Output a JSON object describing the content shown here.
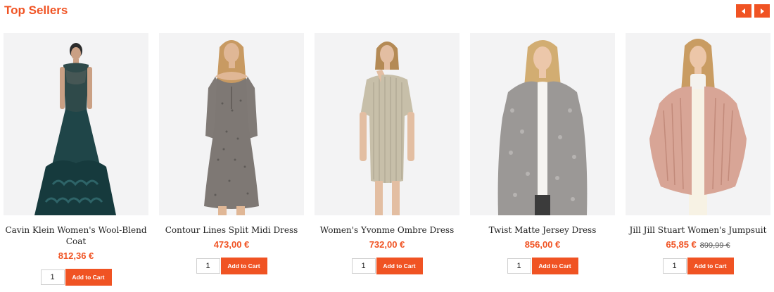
{
  "section": {
    "title": "Top Sellers"
  },
  "nav": {
    "prev_icon": "caret-left-icon",
    "next_icon": "caret-right-icon"
  },
  "colors": {
    "accent": "#f05323",
    "image_bg": "#f3f3f4"
  },
  "products": [
    {
      "name": "Cavin Klein Women's Wool-Blend Coat",
      "price": "812,36 €",
      "old_price": "",
      "qty": "1",
      "cart_label": "Add to Cart",
      "image": "woman-in-dark-teal-gown"
    },
    {
      "name": "Contour Lines Split Midi Dress",
      "price": "473,00 €",
      "old_price": "",
      "qty": "1",
      "cart_label": "Add to Cart",
      "image": "woman-in-grey-print-mini-dress"
    },
    {
      "name": "Women's Yvonme Ombre Dress",
      "price": "732,00 €",
      "old_price": "",
      "qty": "1",
      "cart_label": "Add to Cart",
      "image": "woman-in-pleated-silver-dress"
    },
    {
      "name": "Twist Matte Jersey Dress",
      "price": "856,00 €",
      "old_price": "",
      "qty": "1",
      "cart_label": "Add to Cart",
      "image": "woman-in-grey-knit-cardigan"
    },
    {
      "name": "Jill Jill Stuart Women's Jumpsuit",
      "price": "65,85 €",
      "old_price": "899,99 €",
      "qty": "1",
      "cart_label": "Add to Cart",
      "image": "woman-in-pink-faux-fur-jacket"
    }
  ]
}
